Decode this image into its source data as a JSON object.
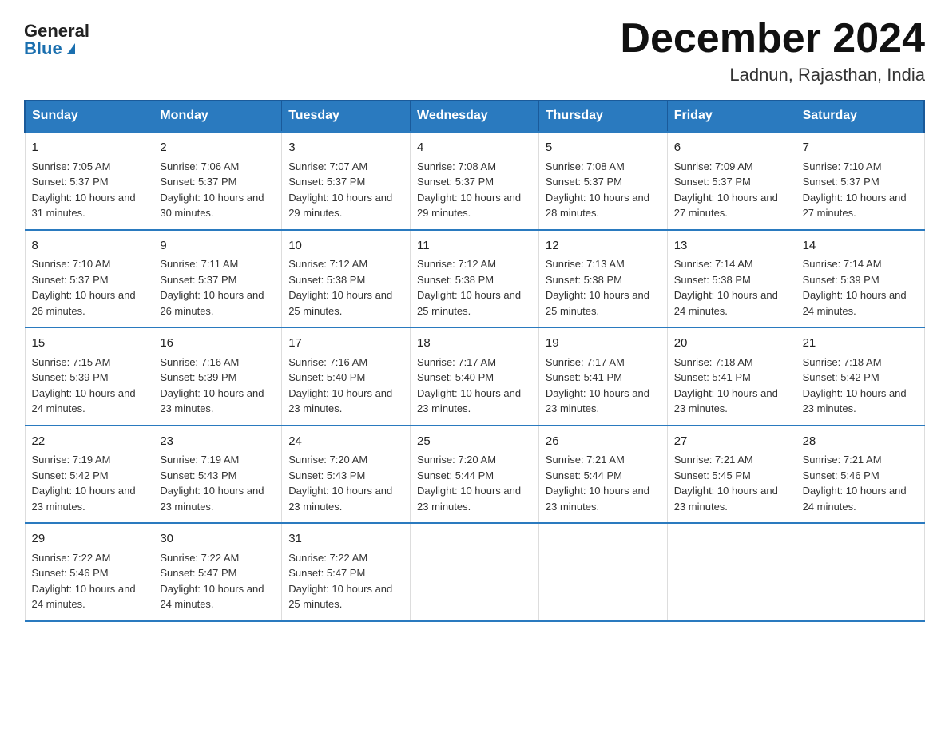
{
  "header": {
    "logo_general": "General",
    "logo_blue": "Blue",
    "month_title": "December 2024",
    "location": "Ladnun, Rajasthan, India"
  },
  "days_of_week": [
    "Sunday",
    "Monday",
    "Tuesday",
    "Wednesday",
    "Thursday",
    "Friday",
    "Saturday"
  ],
  "weeks": [
    [
      {
        "day": "1",
        "sunrise": "7:05 AM",
        "sunset": "5:37 PM",
        "daylight": "10 hours and 31 minutes."
      },
      {
        "day": "2",
        "sunrise": "7:06 AM",
        "sunset": "5:37 PM",
        "daylight": "10 hours and 30 minutes."
      },
      {
        "day": "3",
        "sunrise": "7:07 AM",
        "sunset": "5:37 PM",
        "daylight": "10 hours and 29 minutes."
      },
      {
        "day": "4",
        "sunrise": "7:08 AM",
        "sunset": "5:37 PM",
        "daylight": "10 hours and 29 minutes."
      },
      {
        "day": "5",
        "sunrise": "7:08 AM",
        "sunset": "5:37 PM",
        "daylight": "10 hours and 28 minutes."
      },
      {
        "day": "6",
        "sunrise": "7:09 AM",
        "sunset": "5:37 PM",
        "daylight": "10 hours and 27 minutes."
      },
      {
        "day": "7",
        "sunrise": "7:10 AM",
        "sunset": "5:37 PM",
        "daylight": "10 hours and 27 minutes."
      }
    ],
    [
      {
        "day": "8",
        "sunrise": "7:10 AM",
        "sunset": "5:37 PM",
        "daylight": "10 hours and 26 minutes."
      },
      {
        "day": "9",
        "sunrise": "7:11 AM",
        "sunset": "5:37 PM",
        "daylight": "10 hours and 26 minutes."
      },
      {
        "day": "10",
        "sunrise": "7:12 AM",
        "sunset": "5:38 PM",
        "daylight": "10 hours and 25 minutes."
      },
      {
        "day": "11",
        "sunrise": "7:12 AM",
        "sunset": "5:38 PM",
        "daylight": "10 hours and 25 minutes."
      },
      {
        "day": "12",
        "sunrise": "7:13 AM",
        "sunset": "5:38 PM",
        "daylight": "10 hours and 25 minutes."
      },
      {
        "day": "13",
        "sunrise": "7:14 AM",
        "sunset": "5:38 PM",
        "daylight": "10 hours and 24 minutes."
      },
      {
        "day": "14",
        "sunrise": "7:14 AM",
        "sunset": "5:39 PM",
        "daylight": "10 hours and 24 minutes."
      }
    ],
    [
      {
        "day": "15",
        "sunrise": "7:15 AM",
        "sunset": "5:39 PM",
        "daylight": "10 hours and 24 minutes."
      },
      {
        "day": "16",
        "sunrise": "7:16 AM",
        "sunset": "5:39 PM",
        "daylight": "10 hours and 23 minutes."
      },
      {
        "day": "17",
        "sunrise": "7:16 AM",
        "sunset": "5:40 PM",
        "daylight": "10 hours and 23 minutes."
      },
      {
        "day": "18",
        "sunrise": "7:17 AM",
        "sunset": "5:40 PM",
        "daylight": "10 hours and 23 minutes."
      },
      {
        "day": "19",
        "sunrise": "7:17 AM",
        "sunset": "5:41 PM",
        "daylight": "10 hours and 23 minutes."
      },
      {
        "day": "20",
        "sunrise": "7:18 AM",
        "sunset": "5:41 PM",
        "daylight": "10 hours and 23 minutes."
      },
      {
        "day": "21",
        "sunrise": "7:18 AM",
        "sunset": "5:42 PM",
        "daylight": "10 hours and 23 minutes."
      }
    ],
    [
      {
        "day": "22",
        "sunrise": "7:19 AM",
        "sunset": "5:42 PM",
        "daylight": "10 hours and 23 minutes."
      },
      {
        "day": "23",
        "sunrise": "7:19 AM",
        "sunset": "5:43 PM",
        "daylight": "10 hours and 23 minutes."
      },
      {
        "day": "24",
        "sunrise": "7:20 AM",
        "sunset": "5:43 PM",
        "daylight": "10 hours and 23 minutes."
      },
      {
        "day": "25",
        "sunrise": "7:20 AM",
        "sunset": "5:44 PM",
        "daylight": "10 hours and 23 minutes."
      },
      {
        "day": "26",
        "sunrise": "7:21 AM",
        "sunset": "5:44 PM",
        "daylight": "10 hours and 23 minutes."
      },
      {
        "day": "27",
        "sunrise": "7:21 AM",
        "sunset": "5:45 PM",
        "daylight": "10 hours and 23 minutes."
      },
      {
        "day": "28",
        "sunrise": "7:21 AM",
        "sunset": "5:46 PM",
        "daylight": "10 hours and 24 minutes."
      }
    ],
    [
      {
        "day": "29",
        "sunrise": "7:22 AM",
        "sunset": "5:46 PM",
        "daylight": "10 hours and 24 minutes."
      },
      {
        "day": "30",
        "sunrise": "7:22 AM",
        "sunset": "5:47 PM",
        "daylight": "10 hours and 24 minutes."
      },
      {
        "day": "31",
        "sunrise": "7:22 AM",
        "sunset": "5:47 PM",
        "daylight": "10 hours and 25 minutes."
      },
      null,
      null,
      null,
      null
    ]
  ],
  "colors": {
    "header_bg": "#2a7abf",
    "logo_blue": "#1a6faf"
  }
}
